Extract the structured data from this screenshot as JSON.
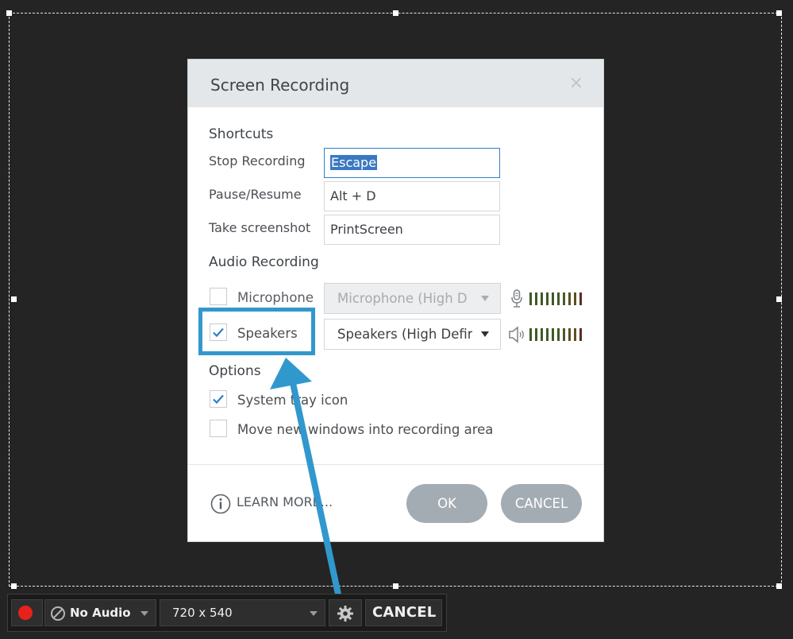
{
  "dialog": {
    "title": "Screen Recording",
    "close_glyph": "×"
  },
  "shortcuts": {
    "heading": "Shortcuts",
    "rows": [
      {
        "label": "Stop Recording",
        "value": "Escape"
      },
      {
        "label": "Pause/Resume",
        "value": "Alt + D"
      },
      {
        "label": "Take screenshot",
        "value": "PrintScreen"
      }
    ]
  },
  "audio": {
    "heading": "Audio Recording",
    "microphone": {
      "label": "Microphone",
      "checked": false,
      "device": "Microphone (High D"
    },
    "speakers": {
      "label": "Speakers",
      "checked": true,
      "device": "Speakers (High Defir"
    }
  },
  "options": {
    "heading": "Options",
    "items": [
      {
        "label": "System tray icon",
        "checked": true
      },
      {
        "label": "Move new windows into recording area",
        "checked": false
      }
    ]
  },
  "footer": {
    "learn_more": "LEARN MORE...",
    "ok": "OK",
    "cancel": "CANCEL"
  },
  "toolbar": {
    "audio_label": "No Audio",
    "resolution": "720 x 540",
    "cancel": "CANCEL"
  },
  "colors": {
    "accent": "#3198cd",
    "record": "#e6221b",
    "pill": "#a4acb3"
  }
}
